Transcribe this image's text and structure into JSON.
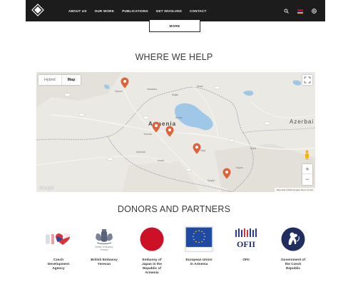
{
  "nav": {
    "items": [
      "ABOUT US",
      "OUR WORK",
      "PUBLICATIONS",
      "GET INVOLVED",
      "CONTACT"
    ]
  },
  "more_button": "MORE",
  "where_section": {
    "title": "WHERE WE HELP",
    "map_type": {
      "hybrid": "Hybrid",
      "map": "Map"
    },
    "country_labels": {
      "armenia": "Armenia",
      "azerbaijan": "Azerbai"
    },
    "city_labels": [
      "Yerevan",
      "Gyumri",
      "Vanadzor",
      "Dilijan",
      "Sevan",
      "Ijevan",
      "Vayk",
      "Goris",
      "Kapan",
      "Artashat",
      "Ararat",
      "Meghri"
    ],
    "google_label": "Google",
    "attribution": "Map data ©2022 Google   Terms of Use"
  },
  "donors_section": {
    "title": "DONORS AND PARTNERS",
    "partners": [
      {
        "name": "Czech\nDevelopment\nAgency",
        "icon": "czech-flag-heart-logo"
      },
      {
        "name": "British Embassy\nYerevan",
        "icon": "royal-coat-of-arms-logo"
      },
      {
        "name": "Embassy of\nJapan in the\nRepublic of\nArmenia",
        "icon": "japan-red-circle-logo"
      },
      {
        "name": "European Union\nin Armenia",
        "icon": "eu-flag-logo"
      },
      {
        "name": "OFII",
        "icon": "ofii-logo"
      },
      {
        "name": "Government of\nthe Czech\nRepublic",
        "icon": "czech-lion-emblem-logo"
      }
    ]
  },
  "colors": {
    "nav_bg": "#1c1c1c",
    "pin": "#e0623a",
    "japan_red": "#cc1126",
    "eu_blue": "#1f4aa3",
    "czech_gov_blue": "#1f2e5f"
  }
}
